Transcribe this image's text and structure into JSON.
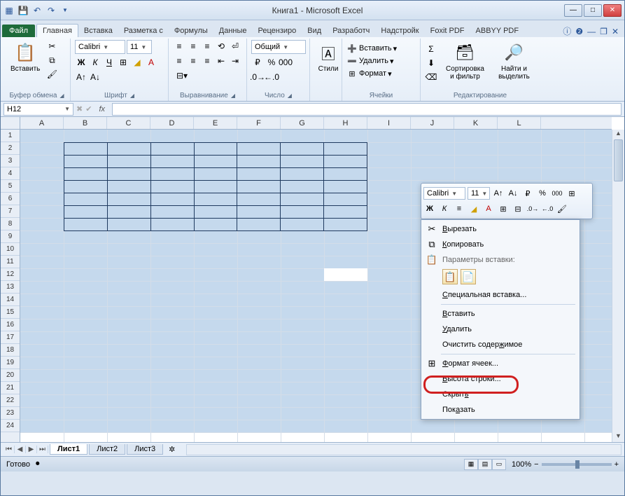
{
  "title": "Книга1  -  Microsoft Excel",
  "tabs": {
    "file": "Файл",
    "list": [
      "Главная",
      "Вставка",
      "Разметка с",
      "Формулы",
      "Данные",
      "Рецензиро",
      "Вид",
      "Разработч",
      "Надстройк",
      "Foxit PDF",
      "ABBYY PDF"
    ],
    "active": 0
  },
  "ribbon": {
    "clipboard": {
      "label": "Буфер обмена",
      "paste": "Вставить"
    },
    "font": {
      "label": "Шрифт",
      "name": "Calibri",
      "size": "11"
    },
    "alignment": {
      "label": "Выравнивание"
    },
    "number": {
      "label": "Число",
      "format": "Общий"
    },
    "styles": {
      "label": "",
      "btn": "Стили"
    },
    "cells": {
      "label": "Ячейки",
      "insert": "Вставить",
      "delete": "Удалить",
      "format": "Формат"
    },
    "editing": {
      "label": "Редактирование",
      "sort": "Сортировка и фильтр",
      "find": "Найти и выделить"
    }
  },
  "namebox": "H12",
  "fx": "fx",
  "columns": [
    "A",
    "B",
    "C",
    "D",
    "E",
    "F",
    "G",
    "H",
    "I",
    "J",
    "K",
    "L"
  ],
  "rows": [
    "1",
    "2",
    "3",
    "4",
    "5",
    "6",
    "7",
    "8",
    "9",
    "10",
    "11",
    "12",
    "13",
    "14",
    "15",
    "16",
    "17",
    "18",
    "19",
    "20",
    "21",
    "22",
    "23",
    "24"
  ],
  "sheets": {
    "list": [
      "Лист1",
      "Лист2",
      "Лист3"
    ],
    "active": 0
  },
  "status": {
    "ready": "Готово",
    "zoom": "100%"
  },
  "mini": {
    "font": "Calibri",
    "size": "11"
  },
  "context": {
    "cut": "Вырезать",
    "copy": "Копировать",
    "paste_header": "Параметры вставки:",
    "paste_special": "Специальная вставка...",
    "insert": "Вставить",
    "delete": "Удалить",
    "clear": "Очистить содержимое",
    "format_cells": "Формат ячеек...",
    "row_height": "Высота строки...",
    "hide": "Скрыть",
    "show": "Показать"
  }
}
